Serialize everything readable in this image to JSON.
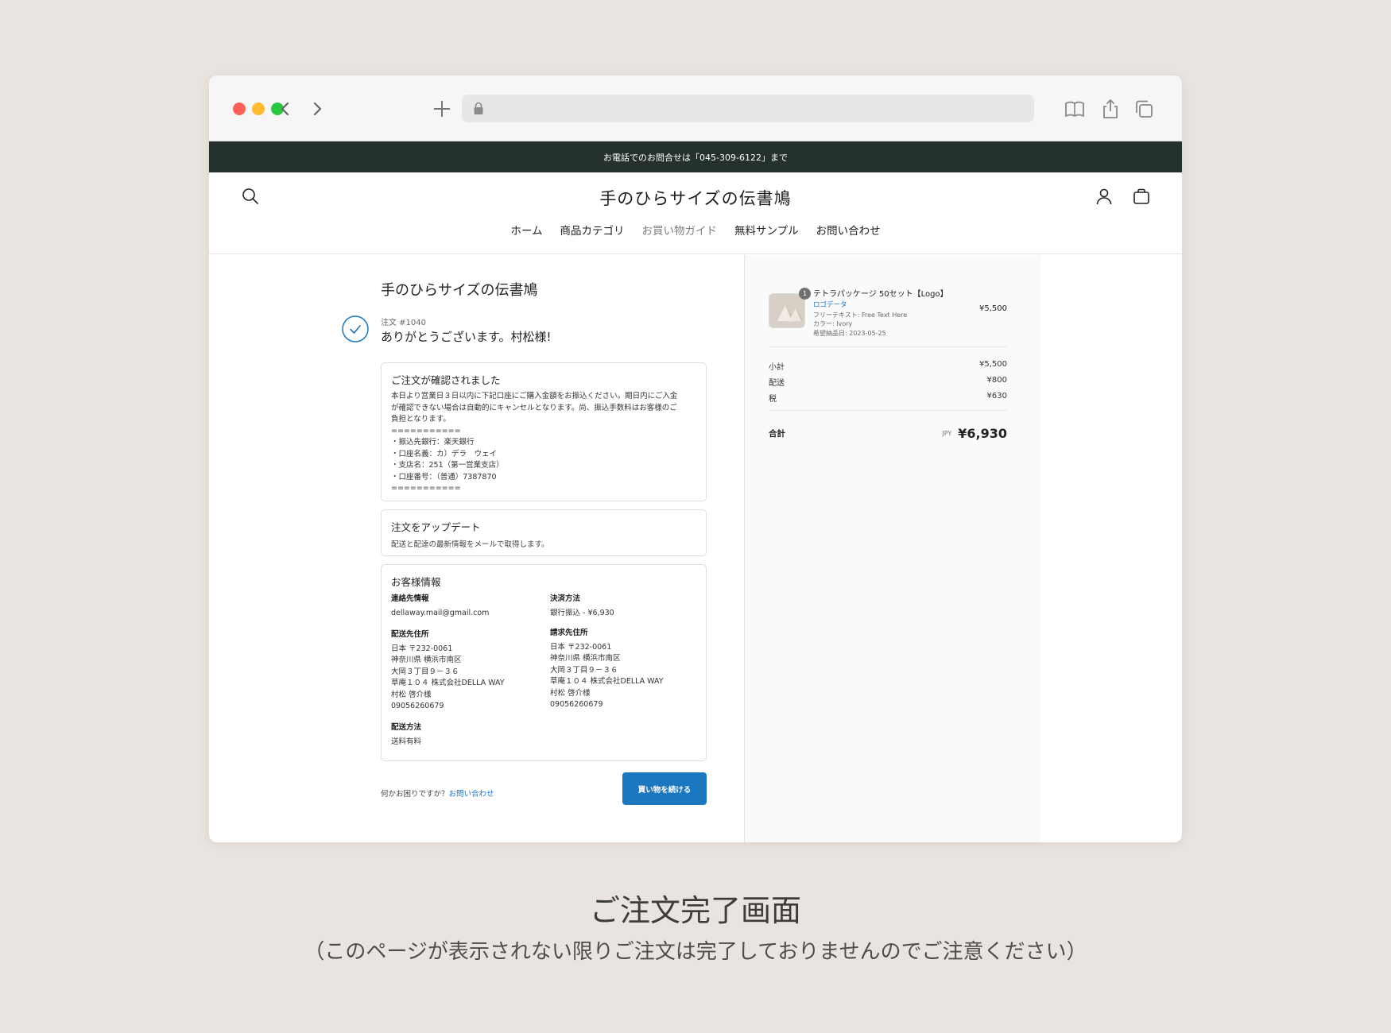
{
  "announcement": "お電話でのお問合せは「045-309-6122」まで",
  "store": {
    "logo": "手のひらサイズの伝書鳩",
    "nav": [
      "ホーム",
      "商品カテゴリ",
      "お買い物ガイド",
      "無料サンプル",
      "お問い合わせ"
    ]
  },
  "checkout": {
    "shop_name": "手のひらサイズの伝書鳩",
    "order_number": "注文 #1040",
    "thanks": "ありがとうございます。村松様!",
    "confirm": {
      "title": "ご注文が確認されました",
      "body": "本日より営業日３日以内に下記口座にご購入金額をお振込ください。期日内にご入金\nが確認できない場合は自動的にキャンセルとなります。尚、振込手数料はお客様のご\n負担となります。\n===========\n・振込先銀行：楽天銀行\n・口座名義：カ）デラ　ウェイ\n・支店名：251（第一営業支店）\n・口座番号：（普通）7387870\n==========="
    },
    "updates": {
      "title": "注文をアップデート",
      "subtitle": "配送と配達の最新情報をメールで取得します。"
    },
    "customer": {
      "title": "お客様情報",
      "contact_label": "連絡先情報",
      "contact_value": "dellaway.mail@gmail.com",
      "payment_label": "決済方法",
      "payment_value": "銀行振込 - ¥6,930",
      "shipping_address_label": "配送先住所",
      "shipping_address": "日本 〒232-0061\n神奈川県 横浜市南区\n大岡３丁目９－３６\n草庵１０４ 株式会社DELLA WAY\n村松 啓介様\n09056260679",
      "billing_address_label": "請求先住所",
      "billing_address": "日本 〒232-0061\n神奈川県 横浜市南区\n大岡３丁目９－３６\n草庵１０４ 株式会社DELLA WAY\n村松 啓介様\n09056260679",
      "shipping_method_label": "配送方法",
      "shipping_method": "送料有料"
    },
    "help_text": "何かお困りですか？",
    "help_link": "お問い合わせ",
    "continue_button": "買い物を続ける"
  },
  "summary": {
    "item": {
      "quantity": "1",
      "name": "テトラパッケージ 50セット【Logo】",
      "variant": "ロゴデータ",
      "attr1": "フリーテキスト: Free Text Here",
      "attr2": "カラー: Ivory",
      "attr3": "希望納品日: 2023-05-25",
      "price": "¥5,500"
    },
    "subtotal_label": "小計",
    "subtotal": "¥5,500",
    "shipping_label": "配送",
    "shipping": "¥800",
    "tax_label": "税",
    "tax": "¥630",
    "total_label": "合計",
    "currency": "JPY",
    "total": "¥6,930"
  },
  "caption": {
    "title": "ご注文完了画面",
    "subtitle": "（このページが表示されない限りご注文は完了しておりませんのでご注意ください）"
  },
  "colors": {
    "announcement_bg": "#25312d",
    "accent_blue": "#1a77c0",
    "page_bg": "#e9e4df"
  }
}
